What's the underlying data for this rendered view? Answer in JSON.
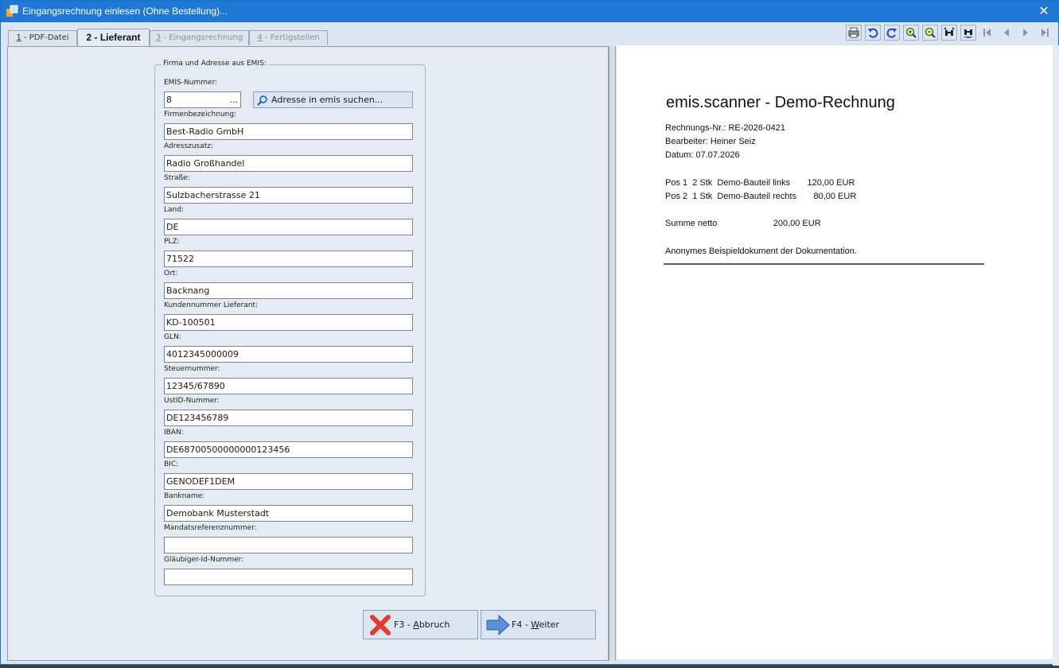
{
  "window": {
    "title": "Eingangsrechnung einlesen (Ohne Bestellung)...",
    "close_glyph": "✕"
  },
  "tabs": [
    {
      "num": "1",
      "label": " - PDF-Datei",
      "state": "normal"
    },
    {
      "num": "2",
      "label": "2 - Lieferant",
      "state": "active"
    },
    {
      "num": "3",
      "label": " - Eingangsrechnung",
      "state": "disabled"
    },
    {
      "num": "4",
      "label": " - Fertigstellen",
      "state": "disabled"
    }
  ],
  "group": {
    "legend": "Firma und Adresse aus EMIS:",
    "search_button": "Adresse in emis suchen...",
    "dots": "...",
    "fields": [
      {
        "label": "EMIS-Nummer:",
        "value": "8"
      },
      {
        "label": "Firmenbezeichnung:",
        "value": "Best-Radio GmbH"
      },
      {
        "label": "Adresszusatz:",
        "value": "Radio Großhandel"
      },
      {
        "label": "Straße:",
        "value": "Sulzbacherstrasse 21"
      },
      {
        "label": "Land:",
        "value": "DE"
      },
      {
        "label": "PLZ:",
        "value": "71522"
      },
      {
        "label": "Ort:",
        "value": "Backnang"
      },
      {
        "label": "Kundennummer Lieferant:",
        "value": "KD-100501"
      },
      {
        "label": "GLN:",
        "value": "4012345000009"
      },
      {
        "label": "Steuernummer:",
        "value": "12345/67890"
      },
      {
        "label": "UstID-Nummer:",
        "value": "DE123456789"
      },
      {
        "label": "IBAN:",
        "value": "DE68700500000000123456"
      },
      {
        "label": "BIC:",
        "value": "GENODEF1DEM"
      },
      {
        "label": "Bankname:",
        "value": "Demobank Musterstadt"
      },
      {
        "label": "Mandatsreferenznummer:",
        "value": ""
      },
      {
        "label": "Gläubiger-Id-Nummer:",
        "value": ""
      }
    ]
  },
  "buttons": {
    "cancel": {
      "prefix": "F3 - ",
      "accel": "A",
      "rest": "bbruch"
    },
    "next": {
      "prefix": "F4 - ",
      "accel": "W",
      "rest": "eiter"
    }
  },
  "toolbar": [
    "print-icon",
    "rotate-left-icon",
    "rotate-right-icon",
    "zoom-in-icon",
    "zoom-out-icon",
    "fit-width-icon",
    "fit-page-icon",
    "first-page-icon",
    "prev-page-icon",
    "next-page-icon",
    "last-page-icon"
  ],
  "document": {
    "title": "emis.scanner - Demo-Rechnung",
    "lines": [
      "Rechnungs-Nr.: RE-2026-0421",
      "Bearbeiter: Heiner Seiz",
      "Datum: 07.07.2026",
      "Pos 1  2 Stk  Demo-Bauteil links       120,00 EUR",
      "Pos 2  1 Stk  Demo-Bauteil rechts       80,00 EUR",
      "Summe netto                       200,00 EUR",
      "Anonymes Beispieldokument der Dokumentation."
    ]
  },
  "colors": {
    "titlebar": "#1e78d4",
    "panel": "#e4ebf3",
    "accent": "#1b73c8"
  }
}
